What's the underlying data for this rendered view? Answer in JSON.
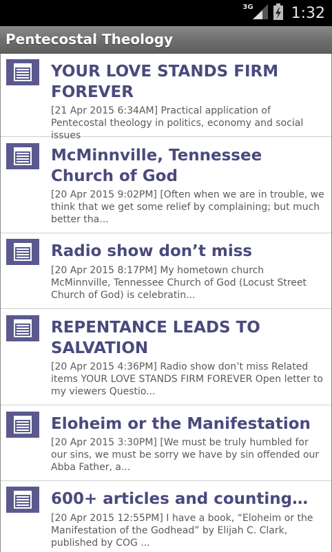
{
  "status_bar": {
    "network": "3G",
    "time": "1:32"
  },
  "app": {
    "title": "Pentecostal Theology"
  },
  "articles": [
    {
      "title": "YOUR LOVE STANDS FIRM FOREVER",
      "summary": "[21 Apr 2015 6:34AM] Practical application of Pentecostal theology in politics, economy and social issues"
    },
    {
      "title": "McMinnville, Tennessee Church of God",
      "summary": "[20 Apr 2015 9:02PM] [Often when we are in trouble, we think that we get some relief by complaining; but much better tha..."
    },
    {
      "title": "Radio show don’t miss",
      "summary": "[20 Apr 2015 8:17PM] My hometown church McMinnville, Tennessee Church of God (Locust Street Church of God) is celebratin..."
    },
    {
      "title": "REPENTANCE LEADS TO SALVATION",
      "summary": "[20 Apr 2015 4:36PM] Radio show don’t miss Related items YOUR LOVE STANDS FIRM FOREVER Open letter to my viewers Questio..."
    },
    {
      "title": "Eloheim or the Manifestation",
      "summary": "[20 Apr 2015 3:30PM] [We must be truly humbled for our sins, we must be sorry we have by sin offended our Abba Father, a..."
    },
    {
      "title": "600+ articles and counting…",
      "summary": "[20 Apr 2015 12:55PM] I have a book, “Eloheim or the Manifestation of the Godhead” by Elijah C. Clark, published by COG ..."
    }
  ]
}
